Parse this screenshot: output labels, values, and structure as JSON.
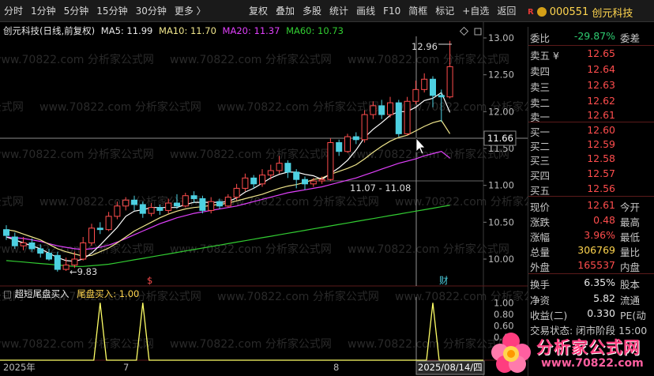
{
  "toolbar": {
    "periods": [
      "分时",
      "1分钟",
      "5分钟",
      "15分钟",
      "30分钟",
      "更多 〉"
    ],
    "tools": [
      "复权",
      "叠加",
      "多股",
      "统计",
      "画线",
      "F10",
      "简框",
      "标记",
      "+自选",
      "返回"
    ]
  },
  "stock": {
    "badge": "R",
    "code": "000551",
    "name": "创元科技"
  },
  "chart_legend": {
    "title": "创元科技(日线,前复权)",
    "ma5": "MA5: 11.99",
    "ma10": "MA10: 11.70",
    "ma20": "MA20: 11.37",
    "ma60": "MA60: 10.73"
  },
  "indicator_legend": {
    "name": "超短尾盘买入",
    "value": "尾盘买入: 1.00"
  },
  "price_axis": [
    "13.00",
    "12.50",
    "12.00",
    "11.50",
    "11.00",
    "10.50",
    "10.00"
  ],
  "indicator_axis": [
    "1.00",
    "0.80",
    "0.60",
    "0.40",
    "0.20"
  ],
  "crosshair_price": "11.66",
  "date_axis": [
    "2025年",
    "7",
    "8"
  ],
  "crosshair_date": "2025/08/14/四",
  "annotations": {
    "high": "12.96",
    "low": "←9.83",
    "range": "11.07 - 11.08",
    "cai": "财",
    "s": "$"
  },
  "watermark": "www.70822.com 分析家公式网",
  "colors": {
    "up": "#ff4d4d",
    "down": "#4dd0e1",
    "ma5": "#ffffff",
    "ma10": "#f0e68c",
    "ma20": "#e040fb",
    "ma60": "#32cd32",
    "indicator": "#ffff66"
  },
  "chart_data": {
    "type": "candlestick",
    "ylim": [
      9.8,
      13.1
    ],
    "candles": [
      {
        "o": 10.4,
        "c": 10.32,
        "h": 10.46,
        "l": 10.26
      },
      {
        "o": 10.3,
        "c": 10.18,
        "h": 10.36,
        "l": 10.14
      },
      {
        "o": 10.18,
        "c": 10.22,
        "h": 10.3,
        "l": 10.12
      },
      {
        "o": 10.22,
        "c": 10.14,
        "h": 10.28,
        "l": 10.1
      },
      {
        "o": 10.14,
        "c": 10.08,
        "h": 10.2,
        "l": 10.02
      },
      {
        "o": 10.08,
        "c": 10.0,
        "h": 10.14,
        "l": 9.98
      },
      {
        "o": 10.05,
        "c": 9.86,
        "h": 10.1,
        "l": 9.83
      },
      {
        "o": 9.86,
        "c": 9.92,
        "h": 10.02,
        "l": 9.84
      },
      {
        "o": 9.92,
        "c": 10.0,
        "h": 10.1,
        "l": 9.88
      },
      {
        "o": 10.0,
        "c": 10.22,
        "h": 10.3,
        "l": 9.98
      },
      {
        "o": 10.22,
        "c": 10.42,
        "h": 10.48,
        "l": 10.18
      },
      {
        "o": 10.42,
        "c": 10.4,
        "h": 10.5,
        "l": 10.34
      },
      {
        "o": 10.4,
        "c": 10.58,
        "h": 10.64,
        "l": 10.38
      },
      {
        "o": 10.58,
        "c": 10.72,
        "h": 10.78,
        "l": 10.54
      },
      {
        "o": 10.72,
        "c": 10.8,
        "h": 10.84,
        "l": 10.66
      },
      {
        "o": 10.8,
        "c": 10.74,
        "h": 10.86,
        "l": 10.66
      },
      {
        "o": 10.74,
        "c": 10.62,
        "h": 10.78,
        "l": 10.56
      },
      {
        "o": 10.62,
        "c": 10.7,
        "h": 10.76,
        "l": 10.58
      },
      {
        "o": 10.7,
        "c": 10.66,
        "h": 10.74,
        "l": 10.6
      },
      {
        "o": 10.66,
        "c": 10.76,
        "h": 10.82,
        "l": 10.62
      },
      {
        "o": 10.76,
        "c": 10.72,
        "h": 10.88,
        "l": 10.68
      },
      {
        "o": 10.72,
        "c": 10.86,
        "h": 10.9,
        "l": 10.7
      },
      {
        "o": 10.86,
        "c": 10.82,
        "h": 10.92,
        "l": 10.76
      },
      {
        "o": 10.82,
        "c": 10.66,
        "h": 10.86,
        "l": 10.62
      },
      {
        "o": 10.66,
        "c": 10.78,
        "h": 10.84,
        "l": 10.62
      },
      {
        "o": 10.78,
        "c": 10.72,
        "h": 10.82,
        "l": 10.68
      },
      {
        "o": 10.72,
        "c": 10.84,
        "h": 10.88,
        "l": 10.7
      },
      {
        "o": 10.84,
        "c": 10.96,
        "h": 11.02,
        "l": 10.8
      },
      {
        "o": 10.96,
        "c": 11.1,
        "h": 11.16,
        "l": 10.92
      },
      {
        "o": 11.1,
        "c": 11.02,
        "h": 11.14,
        "l": 10.96
      },
      {
        "o": 11.02,
        "c": 11.14,
        "h": 11.22,
        "l": 10.98
      },
      {
        "o": 11.14,
        "c": 11.2,
        "h": 11.28,
        "l": 11.08
      },
      {
        "o": 11.2,
        "c": 11.3,
        "h": 11.4,
        "l": 11.16
      },
      {
        "o": 11.3,
        "c": 11.18,
        "h": 11.34,
        "l": 11.1
      },
      {
        "o": 11.18,
        "c": 11.08,
        "h": 11.22,
        "l": 10.96
      },
      {
        "o": 11.08,
        "c": 11.02,
        "h": 11.12,
        "l": 10.94
      },
      {
        "o": 11.02,
        "c": 11.06,
        "h": 11.1,
        "l": 10.98
      },
      {
        "o": 11.06,
        "c": 11.08,
        "h": 11.12,
        "l": 11.02
      },
      {
        "o": 11.08,
        "c": 11.58,
        "h": 11.64,
        "l": 11.06
      },
      {
        "o": 11.58,
        "c": 11.46,
        "h": 11.62,
        "l": 11.4
      },
      {
        "o": 11.46,
        "c": 11.66,
        "h": 11.7,
        "l": 11.44
      },
      {
        "o": 11.66,
        "c": 11.62,
        "h": 11.72,
        "l": 11.56
      },
      {
        "o": 11.62,
        "c": 11.96,
        "h": 12.02,
        "l": 11.58
      },
      {
        "o": 11.96,
        "c": 12.08,
        "h": 12.14,
        "l": 11.9
      },
      {
        "o": 12.08,
        "c": 11.96,
        "h": 12.16,
        "l": 11.9
      },
      {
        "o": 11.96,
        "c": 12.12,
        "h": 12.2,
        "l": 11.92
      },
      {
        "o": 12.12,
        "c": 11.7,
        "h": 12.16,
        "l": 11.66
      },
      {
        "o": 11.7,
        "c": 12.14,
        "h": 12.2,
        "l": 11.68
      },
      {
        "o": 12.14,
        "c": 12.3,
        "h": 12.42,
        "l": 12.1
      },
      {
        "o": 12.3,
        "c": 12.44,
        "h": 12.52,
        "l": 12.26
      },
      {
        "o": 12.44,
        "c": 12.22,
        "h": 12.48,
        "l": 12.06
      },
      {
        "o": 12.22,
        "c": 12.2,
        "h": 12.3,
        "l": 11.86
      },
      {
        "o": 12.2,
        "c": 12.61,
        "h": 12.96,
        "l": 12.18
      }
    ],
    "ma5": [
      10.3,
      10.26,
      10.22,
      10.18,
      10.14,
      10.08,
      10.02,
      9.98,
      9.97,
      10.0,
      10.08,
      10.19,
      10.31,
      10.43,
      10.58,
      10.65,
      10.67,
      10.7,
      10.7,
      10.7,
      10.7,
      10.74,
      10.77,
      10.77,
      10.77,
      10.77,
      10.78,
      10.83,
      10.91,
      10.96,
      11.03,
      11.1,
      11.15,
      11.18,
      11.18,
      11.15,
      11.13,
      11.08,
      11.16,
      11.24,
      11.34,
      11.48,
      11.65,
      11.76,
      11.85,
      11.95,
      12.0,
      12.0,
      12.06,
      12.15,
      12.18,
      12.26,
      11.99
    ],
    "ma10": [
      10.4,
      10.38,
      10.34,
      10.3,
      10.26,
      10.2,
      10.14,
      10.1,
      10.07,
      10.04,
      10.05,
      10.1,
      10.15,
      10.22,
      10.3,
      10.38,
      10.44,
      10.5,
      10.56,
      10.61,
      10.65,
      10.68,
      10.7,
      10.71,
      10.73,
      10.74,
      10.76,
      10.79,
      10.82,
      10.85,
      10.88,
      10.92,
      10.96,
      10.99,
      11.01,
      11.04,
      11.08,
      11.1,
      11.15,
      11.19,
      11.23,
      11.28,
      11.36,
      11.45,
      11.53,
      11.6,
      11.65,
      11.68,
      11.74,
      11.8,
      11.85,
      11.88,
      11.7
    ],
    "ma20": [
      10.3,
      10.29,
      10.28,
      10.26,
      10.24,
      10.21,
      10.18,
      10.16,
      10.14,
      10.13,
      10.14,
      10.16,
      10.19,
      10.23,
      10.28,
      10.33,
      10.38,
      10.43,
      10.48,
      10.52,
      10.56,
      10.59,
      10.62,
      10.64,
      10.66,
      10.68,
      10.7,
      10.72,
      10.75,
      10.78,
      10.81,
      10.84,
      10.87,
      10.9,
      10.92,
      10.94,
      10.96,
      10.98,
      11.01,
      11.04,
      11.07,
      11.1,
      11.14,
      11.18,
      11.22,
      11.26,
      11.3,
      11.33,
      11.36,
      11.4,
      11.43,
      11.46,
      11.37
    ],
    "ma60": [
      9.98,
      9.97,
      9.96,
      9.95,
      9.94,
      9.93,
      9.92,
      9.91,
      9.9,
      9.9,
      9.91,
      9.92,
      9.93,
      9.95,
      9.97,
      9.99,
      10.01,
      10.03,
      10.05,
      10.07,
      10.09,
      10.11,
      10.13,
      10.15,
      10.17,
      10.19,
      10.21,
      10.23,
      10.25,
      10.27,
      10.29,
      10.31,
      10.33,
      10.35,
      10.37,
      10.39,
      10.41,
      10.43,
      10.45,
      10.47,
      10.49,
      10.51,
      10.53,
      10.55,
      10.57,
      10.59,
      10.61,
      10.63,
      10.65,
      10.67,
      10.69,
      10.71,
      10.73
    ],
    "indicator_spikes": [
      11,
      16,
      50
    ],
    "indicator_ylim": [
      0,
      1.1
    ]
  },
  "quote": {
    "weibi": {
      "label": "委比",
      "value": "-29.87%",
      "label2": "委差"
    },
    "sells": [
      {
        "label": "卖五 ¥",
        "value": "12.65"
      },
      {
        "label": "卖四",
        "value": "12.64"
      },
      {
        "label": "卖三",
        "value": "12.63"
      },
      {
        "label": "卖二",
        "value": "12.62"
      },
      {
        "label": "卖一",
        "value": "12.61"
      }
    ],
    "buys": [
      {
        "label": "买一",
        "value": "12.60"
      },
      {
        "label": "买二",
        "value": "12.59"
      },
      {
        "label": "买三",
        "value": "12.58"
      },
      {
        "label": "买四",
        "value": "12.57"
      },
      {
        "label": "买五",
        "value": "12.56"
      }
    ],
    "stats": [
      {
        "label": "现价",
        "value": "12.61",
        "label2": "今开"
      },
      {
        "label": "涨跌",
        "value": "0.48",
        "label2": "最高"
      },
      {
        "label": "涨幅",
        "value": "3.96%",
        "label2": "最低"
      },
      {
        "label": "总量",
        "value": "306769",
        "label2": "量比"
      },
      {
        "label": "外盘",
        "value": "165537",
        "label2": "内盘"
      }
    ],
    "stats2": [
      {
        "label": "换手",
        "value": "6.35%",
        "label2": "股本"
      },
      {
        "label": "净资",
        "value": "5.82",
        "label2": "流通"
      },
      {
        "label": "收益(二)",
        "value": "0.330",
        "label2": "PE(动"
      }
    ],
    "status": "交易状态: 闭市阶段 15:00"
  },
  "logo": {
    "text": "分析家公式网",
    "url": "www.70822.com"
  }
}
